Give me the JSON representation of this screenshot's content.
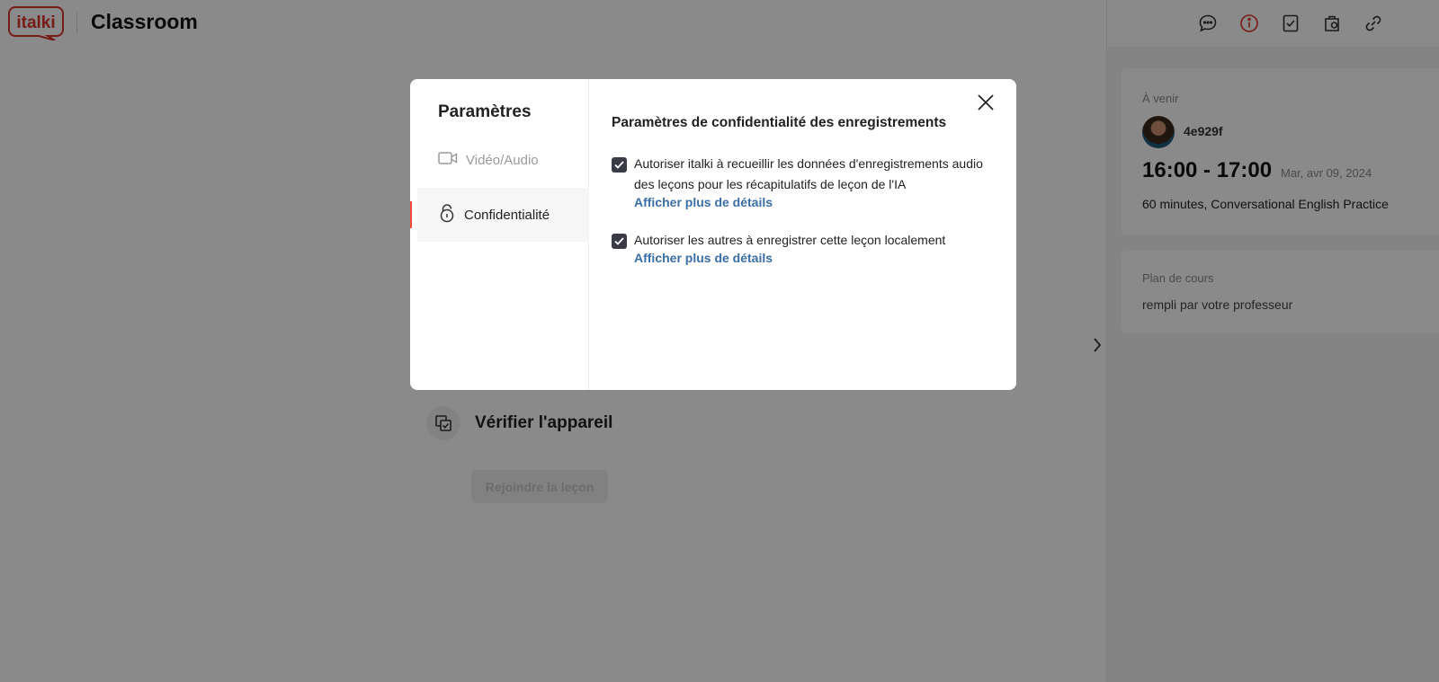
{
  "header": {
    "logo_text": "italki",
    "title": "Classroom"
  },
  "page": {
    "device_check_label": "Vérifier l'appareil",
    "join_button_label": "Rejoindre la leçon"
  },
  "sidebar": {
    "toolbar_icons": [
      "chat-icon",
      "info-icon",
      "notes-icon",
      "materials-icon",
      "link-icon"
    ],
    "active_icon": "info-icon",
    "upcoming": {
      "label": "À venir",
      "tutor_name": "4e929f",
      "time_range": "16:00 - 17:00",
      "date": "Mar, avr 09, 2024",
      "description": "60 minutes, Conversational English Practice"
    },
    "lesson_plan": {
      "label": "Plan de cours",
      "text": "rempli par votre professeur"
    }
  },
  "modal": {
    "title": "Paramètres",
    "nav": [
      {
        "label": "Vidéo/Audio",
        "icon": "video-camera-icon",
        "active": false
      },
      {
        "label": "Confidentialité",
        "icon": "lock-icon",
        "active": true
      }
    ],
    "section_title": "Paramètres de confidentialité des enregistrements",
    "options": [
      {
        "text": "Autoriser italki à recueillir les données d'enregistrements audio des leçons pour les récapitulatifs de leçon de l'IA",
        "checked": true,
        "link": "Afficher plus de détails"
      },
      {
        "text": "Autoriser les autres à enregistrer cette leçon localement",
        "checked": true,
        "link": "Afficher plus de détails"
      }
    ]
  },
  "colors": {
    "brand": "#d9342b",
    "link": "#3a6ea5",
    "accent": "#ff4b3e",
    "checkbox": "#3b3b48"
  }
}
